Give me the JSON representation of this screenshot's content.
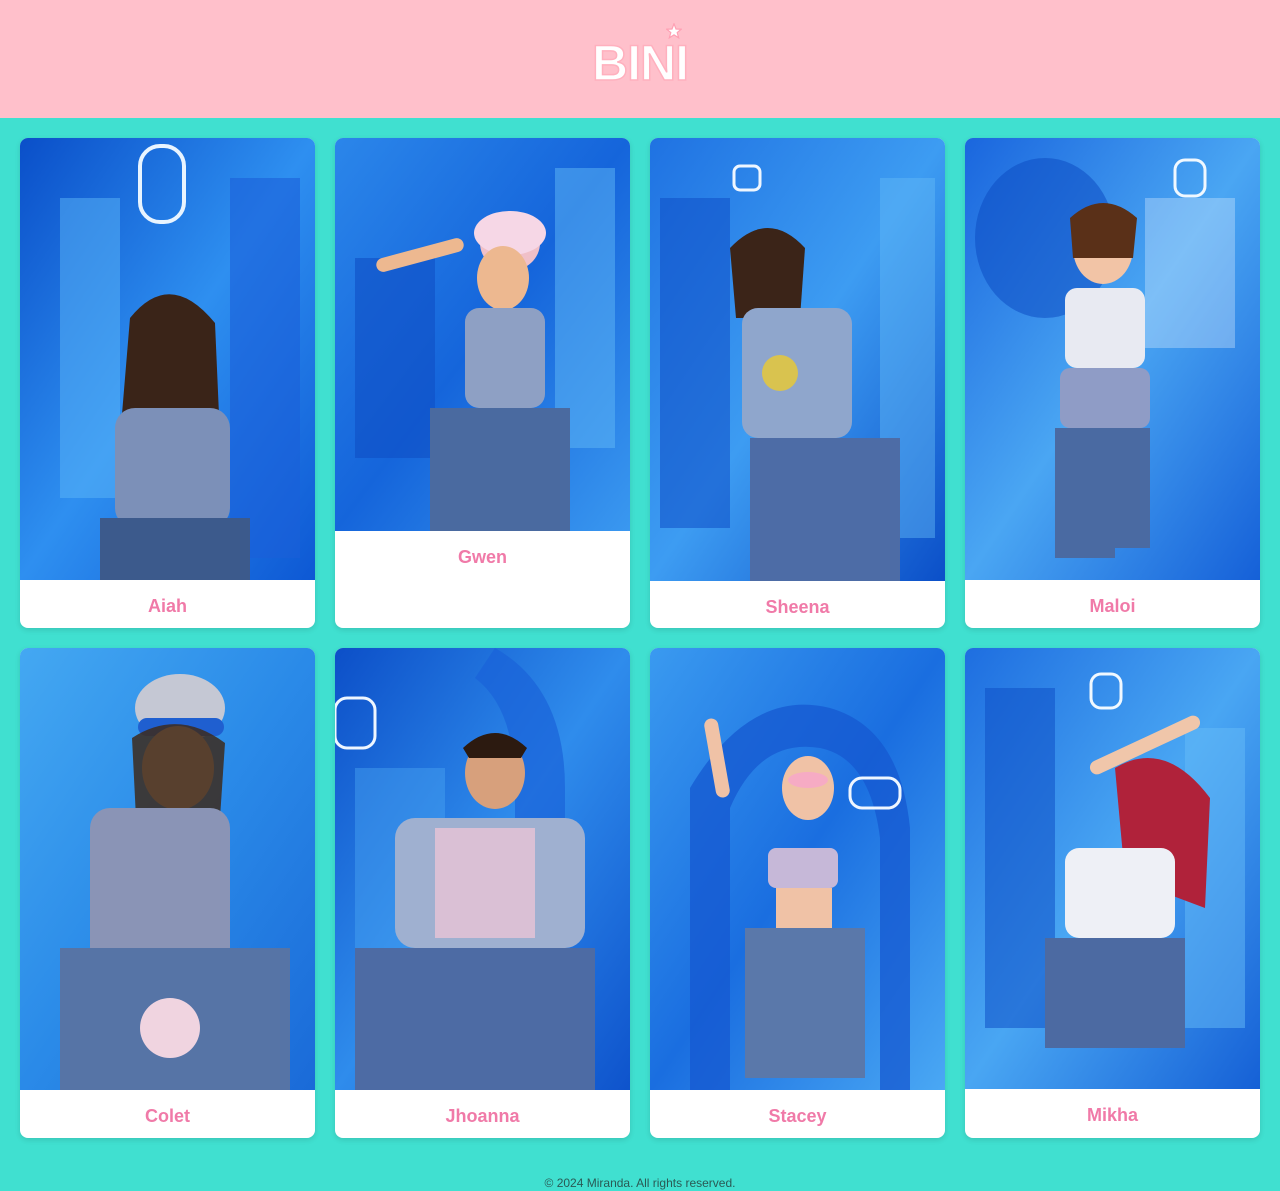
{
  "header": {
    "logo_text": "BINI",
    "logo_icon": "star-icon"
  },
  "members": [
    {
      "name": "Aiah"
    },
    {
      "name": "Gwen"
    },
    {
      "name": "Sheena"
    },
    {
      "name": "Maloi"
    },
    {
      "name": "Colet"
    },
    {
      "name": "Jhoanna"
    },
    {
      "name": "Stacey"
    },
    {
      "name": "Mikha"
    }
  ],
  "footer": {
    "copyright": "© 2024 Miranda. All rights reserved."
  },
  "colors": {
    "header_bg": "#ffc0cb",
    "page_bg": "#40e0d0",
    "name_color": "#f07aa8",
    "photo_blue": "#1e6fe0"
  }
}
